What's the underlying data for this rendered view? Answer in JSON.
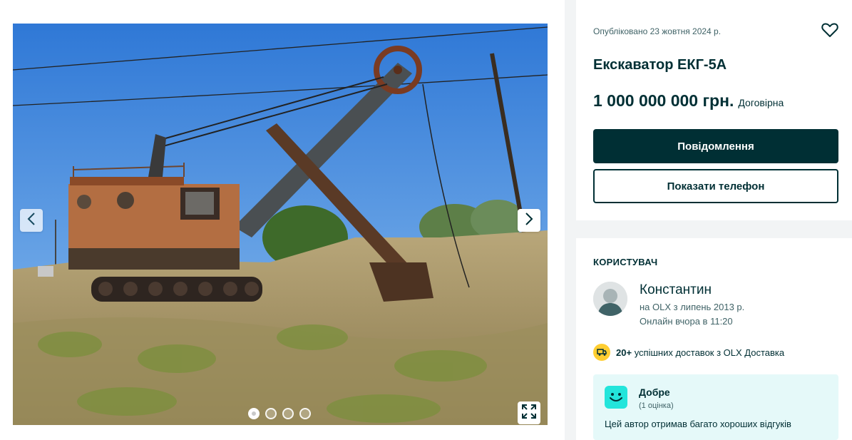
{
  "listing": {
    "published": "Опубліковано 23 жовтня 2024 р.",
    "title": "Екскаватор ЕКГ-5А",
    "price": "1 000 000 000 грн.",
    "negotiable": "Договірна",
    "message_button": "Повідомлення",
    "phone_button": "Показати телефон",
    "favorite_icon": "heart-outline-icon"
  },
  "gallery": {
    "image_subject": "rusty-excavator-photo",
    "photo_count": 4,
    "current_photo": 1,
    "icons": {
      "prev": "chevron-left-icon",
      "next": "chevron-right-icon",
      "fullscreen": "expand-icon"
    }
  },
  "seller": {
    "heading": "КОРИСТУВАЧ",
    "name": "Константин",
    "since": "на OLX з липень 2013 р.",
    "online": "Онлайн вчора в 11:20",
    "delivery_count": "20+",
    "delivery_text": "успішних доставок з OLX Доставка",
    "rating": {
      "label": "Добре",
      "count": "(1 оцінка)",
      "description": "Цей автор отримав багато хороших відгуків"
    }
  },
  "colors": {
    "primary": "#002f34",
    "page_bg": "#f2f4f5",
    "rating_bg": "#e5f9f9",
    "smiley": "#23e5db",
    "delivery_badge": "#ffce32"
  }
}
